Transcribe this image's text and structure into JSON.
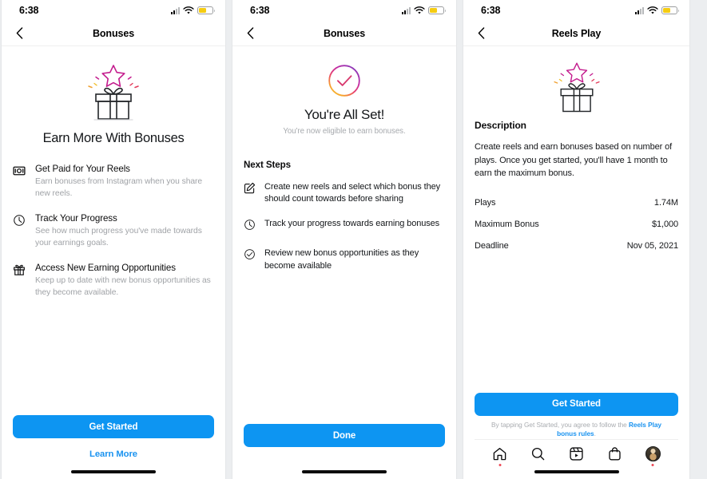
{
  "status_bar": {
    "time": "6:38",
    "signal_icon": "cellular-signal-icon",
    "wifi_icon": "wifi-icon",
    "battery_icon": "battery-low-power-icon",
    "battery_color": "#f5cc12"
  },
  "theme": {
    "accent_blue": "#0d95f2",
    "link_blue": "#1a93f0",
    "notification_red": "#ed4956",
    "muted_text": "#a0a3a7"
  },
  "screen1": {
    "nav_title": "Bonuses",
    "back_icon": "chevron-left-icon",
    "illustration": "gift-box-with-star-icon",
    "hero_title": "Earn More With Bonuses",
    "features": [
      {
        "icon": "money-banknote-icon",
        "title": "Get Paid for Your Reels",
        "desc": "Earn bonuses from Instagram when you share new reels."
      },
      {
        "icon": "clock-icon",
        "title": "Track Your Progress",
        "desc": "See how much progress you've made towards your earnings goals."
      },
      {
        "icon": "gift-icon",
        "title": "Access New Earning Opportunities",
        "desc": "Keep up to date with new bonus opportunities as they become available."
      }
    ],
    "primary_button": "Get Started",
    "secondary_link": "Learn More"
  },
  "screen2": {
    "nav_title": "Bonuses",
    "back_icon": "chevron-left-icon",
    "check_icon": "gradient-check-circle-icon",
    "title": "You're All Set!",
    "subtitle": "You're now eligible to earn bonuses.",
    "section_title": "Next Steps",
    "steps": [
      {
        "icon": "compose-edit-icon",
        "text": "Create new reels and select which bonus they should count towards before sharing"
      },
      {
        "icon": "clock-icon",
        "text": "Track your progress towards earning bonuses"
      },
      {
        "icon": "check-circle-icon",
        "text": "Review new bonus opportunities as they become available"
      }
    ],
    "primary_button": "Done"
  },
  "screen3": {
    "nav_title": "Reels Play",
    "back_icon": "chevron-left-icon",
    "illustration": "gift-box-with-star-icon",
    "description_heading": "Description",
    "description_body": "Create reels and earn bonuses based on number of plays. Once you get started, you'll have 1 month to earn the maximum bonus.",
    "stats": [
      {
        "label": "Plays",
        "value": "1.74M"
      },
      {
        "label": "Maximum Bonus",
        "value": "$1,000"
      },
      {
        "label": "Deadline",
        "value": "Nov 05, 2021"
      }
    ],
    "primary_button": "Get Started",
    "disclaimer_prefix": "By tapping Get Started, you agree to follow the ",
    "disclaimer_link": "Reels Play bonus rules",
    "disclaimer_suffix": ".",
    "tabs": [
      {
        "icon": "home-icon",
        "badge": true
      },
      {
        "icon": "search-icon",
        "badge": false
      },
      {
        "icon": "reels-icon",
        "badge": false
      },
      {
        "icon": "shop-bag-icon",
        "badge": false
      },
      {
        "icon": "profile-avatar-icon",
        "badge": true
      }
    ]
  }
}
